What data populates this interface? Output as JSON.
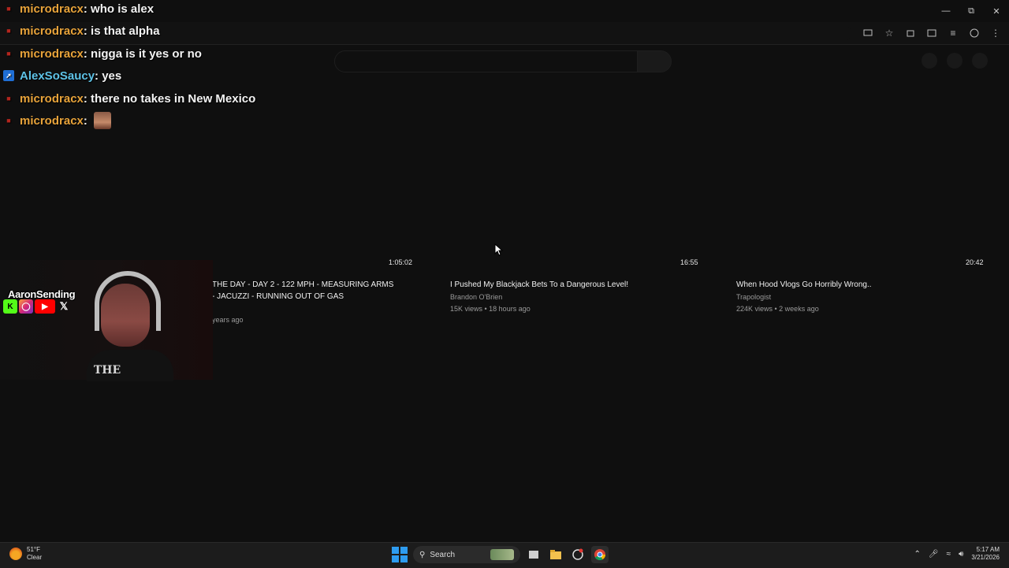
{
  "chat": {
    "messages": [
      {
        "user": "microdracx",
        "sep": " :",
        "text": " who is alex",
        "badge": "red"
      },
      {
        "user": "microdracx",
        "sep": " :",
        "text": " is that alpha",
        "badge": "red"
      },
      {
        "user": "microdracx",
        "sep": " :",
        "text": " nigga is it yes or no",
        "badge": "red"
      },
      {
        "user": "AlexSoSaucy",
        "sep": " :",
        "text": " yes",
        "badge": "blue"
      },
      {
        "user": "microdracx",
        "sep": " :",
        "text": " there no takes in New Mexico",
        "badge": "red"
      },
      {
        "user": "microdracx",
        "sep": " :",
        "text": "",
        "badge": "red"
      }
    ]
  },
  "videos": [
    {
      "duration": "1:05:02",
      "title_line1": "THE DAY - DAY 2 - 122 MPH - MEASURING ARMS",
      "title_line2": "- JACUZZI - RUNNING OUT OF GAS",
      "meta": "years ago"
    },
    {
      "duration": "16:55",
      "title_line1": "I Pushed My Blackjack Bets To a Dangerous Level!",
      "channel": "Brandon O'Brien",
      "meta": "15K views • 18 hours ago"
    },
    {
      "duration": "20:42",
      "title_line1": "When Hood Vlogs Go Horribly Wrong..",
      "channel": "Trapologist",
      "meta": "224K views • 2 weeks ago"
    }
  ],
  "webcam": {
    "streamer_name": "AaronSending",
    "shirt_text": "THE"
  },
  "taskbar": {
    "weather_temp": "51°F",
    "weather_cond": "Clear",
    "search_label": "Search",
    "time": "5:17 AM",
    "date": "3/21/2026"
  },
  "colors": {
    "username": "#e8a33a",
    "username_alt": "#5ec2e6",
    "background": "#0f0f0f"
  }
}
